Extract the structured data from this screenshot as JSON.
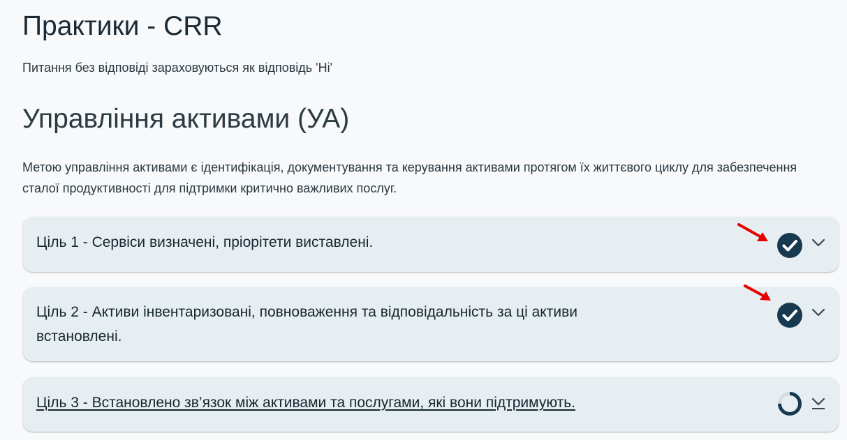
{
  "page": {
    "title": "Практики - CRR",
    "note": "Питання без відповіді зараховуються як відповідь 'Ні'"
  },
  "section": {
    "title": "Управління активами (УА)",
    "description": "Метою управління активами є ідентифікація, документування та керування активами протягом їх життєвого циклу для забезпечення сталої продуктивності для підтримки критично важливих послуг."
  },
  "goals": [
    {
      "label": "Ціль 1 - Сервіси визначені, пріорітети виставлені.",
      "status": "complete",
      "status_icon": "check-circle-icon",
      "toggle_icon": "chevron-down-icon"
    },
    {
      "label": "Ціль 2 - Активи інвентаризовані, повноваження та відповідальність за ці активи встановлені.",
      "status": "complete",
      "status_icon": "check-circle-icon",
      "toggle_icon": "chevron-down-icon"
    },
    {
      "label": "Ціль 3 - Встановлено зв’язок між активами та послугами, які вони підтримують.",
      "status": "in-progress",
      "progress": 0.75,
      "status_icon": "progress-ring-icon",
      "toggle_icon": "chevron-down-icon"
    }
  ],
  "annotations": {
    "arrow_icon": "red-arrow-icon"
  },
  "colors": {
    "background": "#f8f9fa",
    "card": "#e7eef2",
    "accent": "#173a50",
    "progress_track": "#d5dde2",
    "annotation": "#e60000"
  }
}
